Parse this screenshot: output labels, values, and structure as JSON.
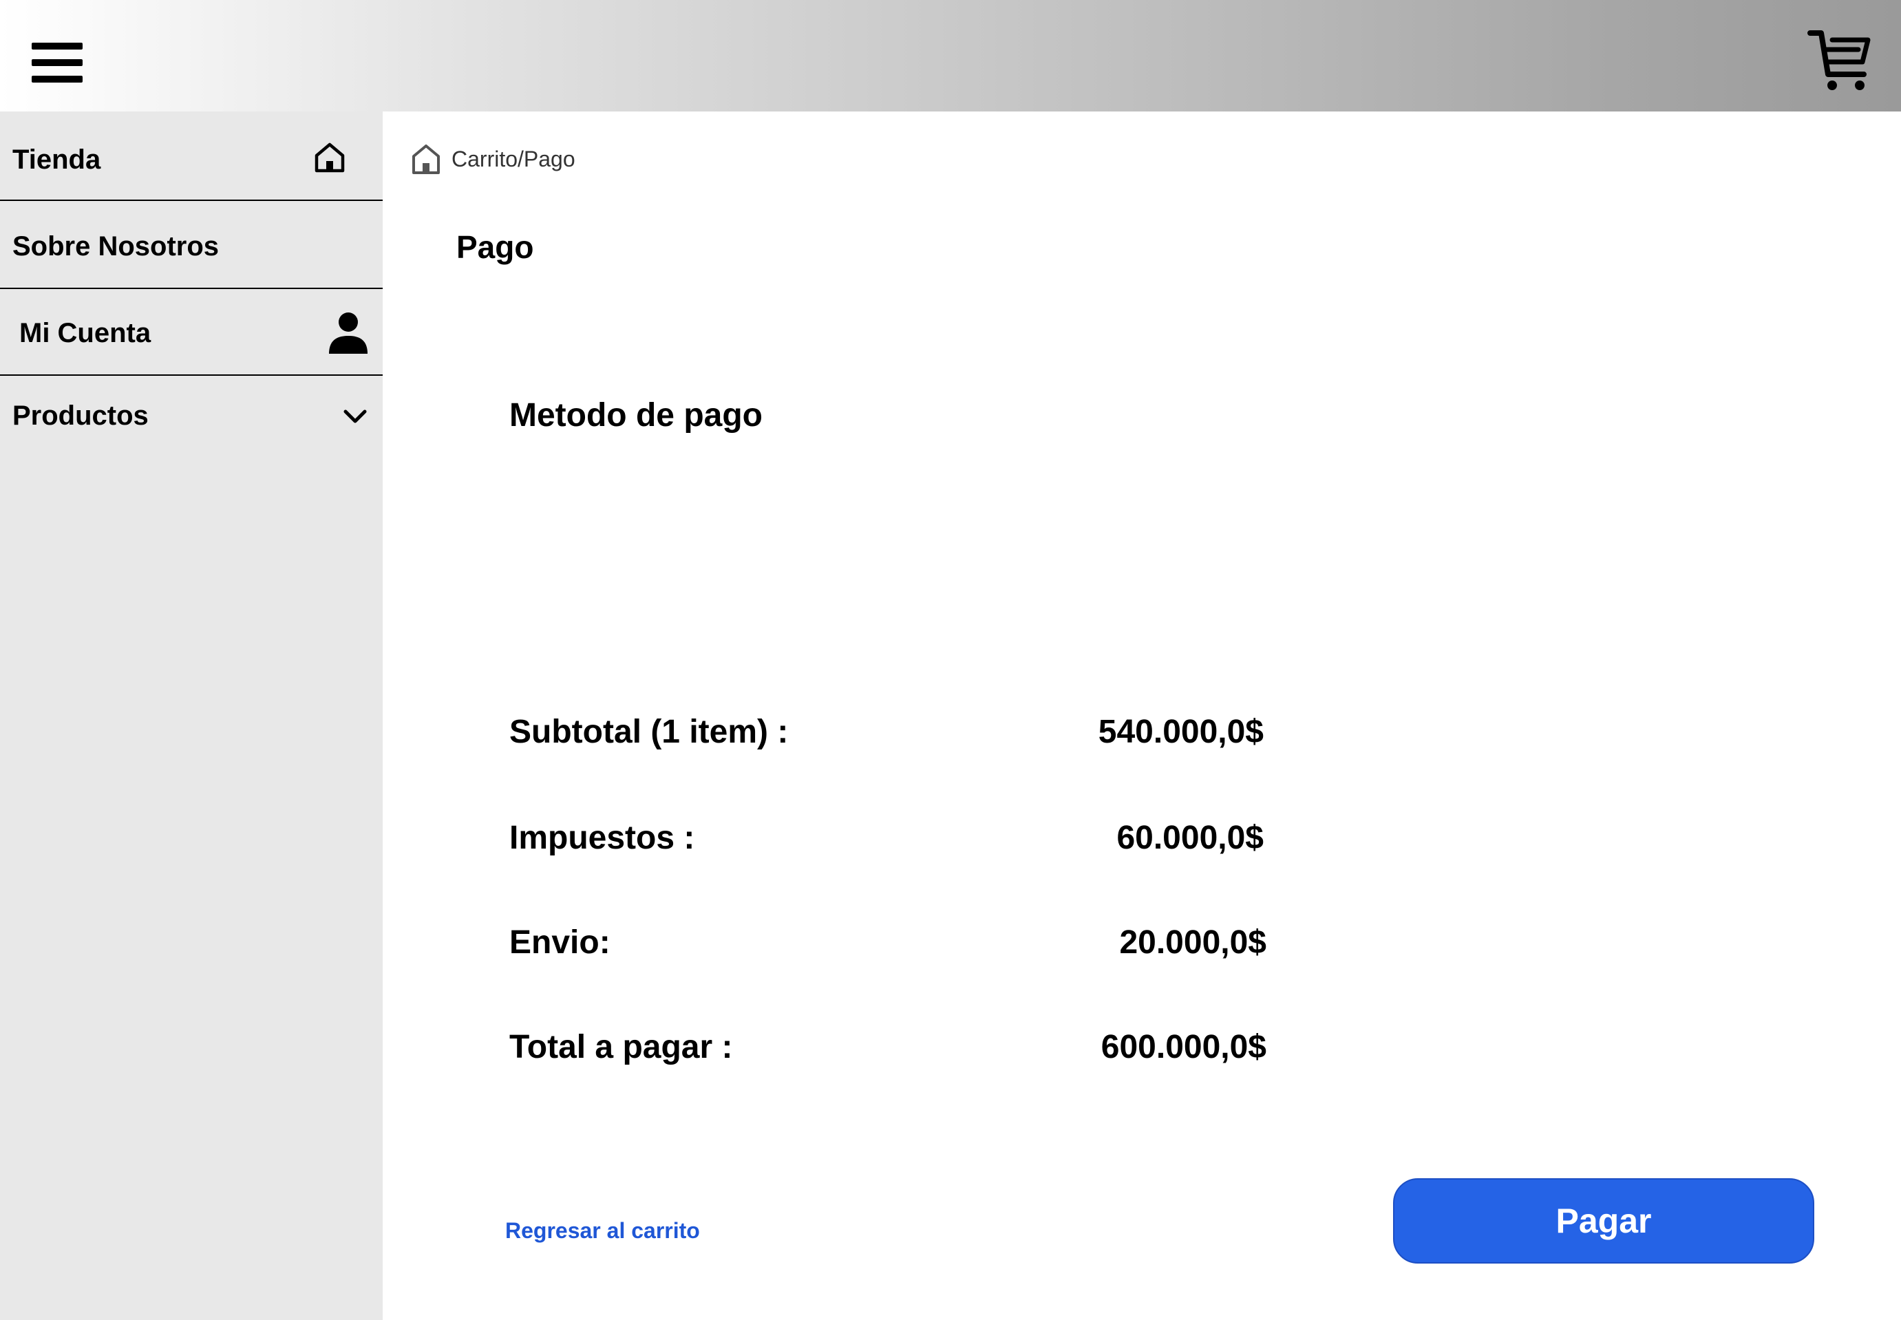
{
  "header": {
    "menu_icon": "hamburger-menu-icon",
    "cart_icon": "shopping-cart-icon"
  },
  "sidebar": {
    "items": [
      {
        "label": "Tienda",
        "icon": "home-icon"
      },
      {
        "label": "Sobre Nosotros",
        "icon": ""
      },
      {
        "label": "Mi Cuenta",
        "icon": "user-icon"
      },
      {
        "label": "Productos",
        "icon": "chevron-down-icon"
      }
    ]
  },
  "breadcrumb": {
    "icon": "home-icon",
    "text": "Carrito/Pago"
  },
  "main": {
    "title": "Pago",
    "payment_method_title": "Metodo de pago",
    "summary": [
      {
        "label": "Subtotal (1  item) :",
        "value": "540.000,0$"
      },
      {
        "label": "Impuestos :",
        "value": "60.000,0$"
      },
      {
        "label": "Envio:",
        "value": "20.000,0$"
      },
      {
        "label": "Total a pagar :",
        "value": "600.000,0$"
      }
    ],
    "back_link": "Regresar al carrito",
    "pay_button": "Pagar"
  },
  "colors": {
    "accent": "#2563e6",
    "link": "#1f57d6",
    "sidebar_bg": "#e8e8e8"
  }
}
